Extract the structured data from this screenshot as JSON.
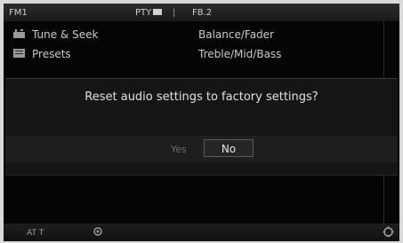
{
  "header": {
    "band": "FM1",
    "status": "PTY",
    "separator": "|",
    "preset": "FB.2"
  },
  "menu": {
    "items": [
      {
        "label": "Tune & Seek",
        "right": "Balance/Fader",
        "icon": "tune-icon"
      },
      {
        "label": "Presets",
        "right": "Treble/Mid/Bass",
        "icon": "presets-icon"
      }
    ]
  },
  "dialog": {
    "message": "Reset audio settings to factory settings?",
    "yes_label": "Yes",
    "no_label": "No"
  },
  "footer": {
    "left_label": "AT T",
    "left_icon": "gear-icon",
    "right_icon": "settings-icon"
  }
}
